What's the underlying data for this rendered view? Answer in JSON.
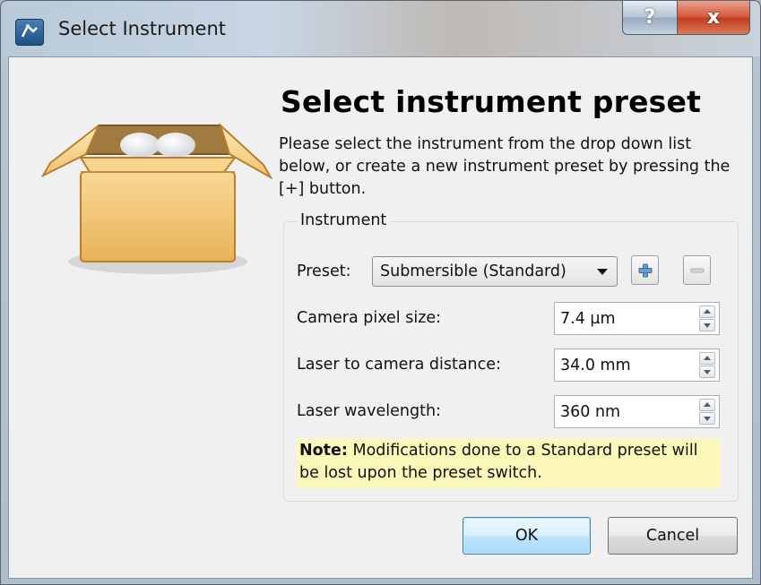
{
  "window": {
    "title": "Select Instrument",
    "help_label": "?",
    "close_label": "x"
  },
  "heading": "Select instrument preset",
  "description": "Please select the instrument from the drop down list below, or create a new instrument preset by pressing the [+] button.",
  "instrument_group": {
    "title": "Instrument",
    "preset_label": "Preset:",
    "preset_value": "Submersible (Standard)",
    "fields": [
      {
        "label": "Camera pixel size:",
        "value": "7.4 µm"
      },
      {
        "label": "Laser to camera distance:",
        "value": "34.0 mm"
      },
      {
        "label": "Laser wavelength:",
        "value": "360 nm"
      }
    ],
    "note_bold": "Note:",
    "note_text": " Modifications done to a Standard preset will be lost upon the preset switch."
  },
  "buttons": {
    "ok": "OK",
    "cancel": "Cancel"
  },
  "icons": {
    "app": "instrument-app-icon",
    "illustration": "open-box-icon",
    "add": "plus-icon",
    "remove": "minus-icon"
  }
}
